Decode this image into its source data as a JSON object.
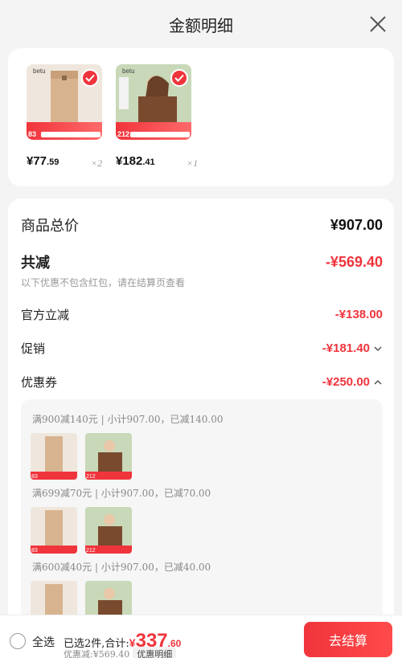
{
  "header": {
    "title": "金额明细"
  },
  "products": [
    {
      "brand": "betu",
      "badge_num": "83",
      "price_int": "¥77",
      "price_cents": ".59",
      "qty": "×2",
      "color": "#d8b38f"
    },
    {
      "brand": "betu",
      "badge_num": "212",
      "price_int": "¥182",
      "price_cents": ".41",
      "qty": "×1",
      "color": "#7a4a2f"
    }
  ],
  "detail": {
    "total_label": "商品总价",
    "total_value": "¥907.00",
    "discount_label": "共减",
    "discount_value": "-¥569.40",
    "discount_note": "以下优惠不包含红包，请在结算页查看",
    "official_label": "官方立减",
    "official_value": "-¥138.00",
    "promo_label": "促销",
    "promo_value": "-¥181.40",
    "coupon_label": "优惠券",
    "coupon_value": "-¥250.00"
  },
  "coupons": [
    {
      "text": "满900减140元 | 小计907.00，已减140.00"
    },
    {
      "text": "满699减70元 | 小计907.00，已减70.00"
    },
    {
      "text": "满600减40元 | 小计907.00，已减40.00"
    }
  ],
  "bottom": {
    "select_all": "全选",
    "selected_text": "已选2件,合计:",
    "total_currency": "¥",
    "total_int": "337",
    "total_cents": ".60",
    "saved_text": "优惠减:¥569.40",
    "detail_tag": "优惠明细",
    "checkout_label": "去结算"
  }
}
